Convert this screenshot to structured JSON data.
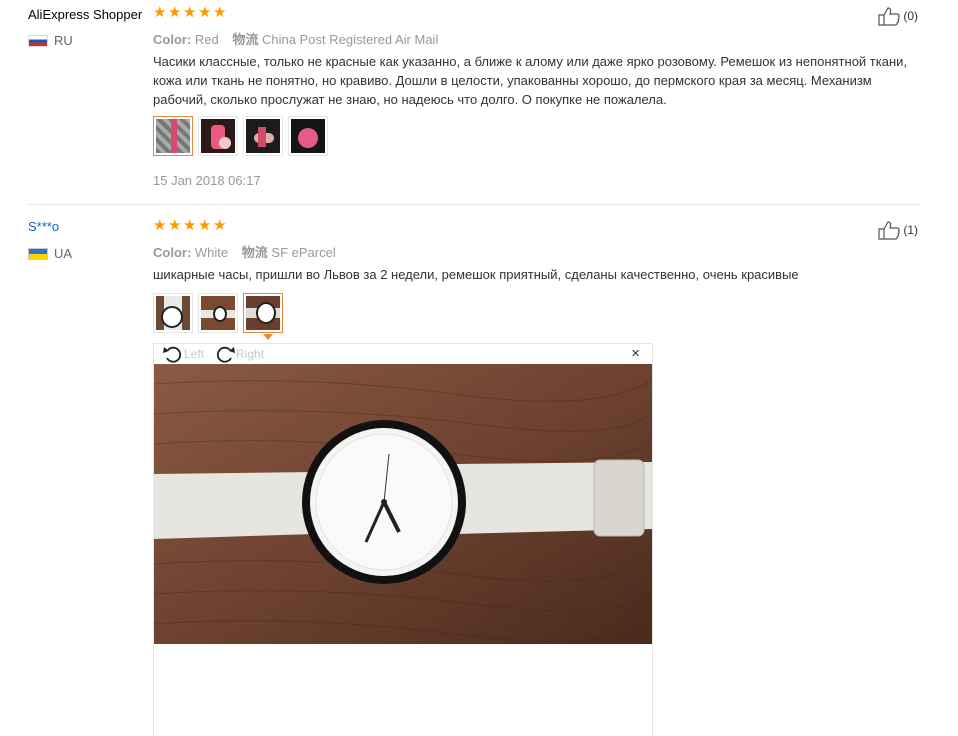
{
  "reviews": [
    {
      "user": "AliExpress Shopper",
      "country": "RU",
      "rating_stars": 5,
      "color_label": "Color:",
      "color_value": "Red",
      "logistics_label": "物流",
      "logistics_value": "China Post Registered Air Mail",
      "text": "Часики классные, только не красные как указанно, а ближе к алому или даже ярко розовому. Ремешок из непонятной ткани, кожа или ткань не понятно, но кравиво. Дошли в целости, упакованны хорошо, до пермского края за месяц. Механизм рабочий, сколько прослужат не знаю, но надеюсь что долго. О покупке не пожалела.",
      "date": "15 Jan 2018 06:17",
      "likes": "(0)",
      "photo_count": 4
    },
    {
      "user": "S***o",
      "country": "UA",
      "rating_stars": 5,
      "color_label": "Color:",
      "color_value": "White",
      "logistics_label": "物流",
      "logistics_value": "SF eParcel",
      "text": "шикарные часы, пришли во Львов за 2 недели, ремешок приятный, сделаны качественно, очень красивые",
      "likes": "(1)",
      "photo_count": 3
    }
  ],
  "viewer": {
    "rotate_left_label": "Left",
    "rotate_right_label": "Right",
    "close_symbol": "×"
  },
  "colors": {
    "star": "#ff9900",
    "accent_border": "#e3893b",
    "link_blue": "#0066cc"
  },
  "icons": [
    "star-icon",
    "thumbs-up-icon",
    "rotate-left-icon",
    "rotate-right-icon",
    "close-icon"
  ]
}
